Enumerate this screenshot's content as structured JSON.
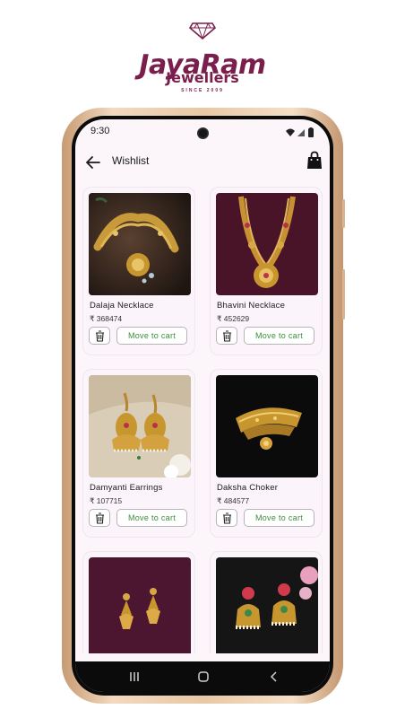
{
  "brand": {
    "name": "JayaRam",
    "subtitle": "Jewellers",
    "since": "SINCE 2009",
    "logo_icon": "diamond-logo-icon",
    "color": "#7a1f4c"
  },
  "status_bar": {
    "time": "9:30",
    "icons": [
      "wifi-icon",
      "signal-icon",
      "battery-icon"
    ]
  },
  "app_bar": {
    "back_icon": "arrow-left-icon",
    "title": "Wishlist",
    "bag_icon": "shopping-bag-icon"
  },
  "wishlist": {
    "currency": "₹",
    "delete_icon": "trash-icon",
    "move_to_cart_label": "Move to cart",
    "accent_color": "#3a8f3a",
    "items": [
      {
        "name": "Dalaja Necklace",
        "price": "₹ 368474",
        "image": "gold-necklace-on-dark-stand"
      },
      {
        "name": "Bhavini Necklace",
        "price": "₹ 452629",
        "image": "long-gold-necklace-on-maroon"
      },
      {
        "name": "Damyanti Earrings",
        "price": "₹ 107715",
        "image": "jhumka-earrings-on-cream"
      },
      {
        "name": "Daksha Choker",
        "price": "₹ 484577",
        "image": "gold-choker-on-black"
      },
      {
        "name": "",
        "price": "",
        "image": "drop-earrings-on-maroon"
      },
      {
        "name": "",
        "price": "",
        "image": "kundan-jhumkas-on-dark"
      }
    ]
  },
  "nav_bar": {
    "items": [
      "recents-icon",
      "home-icon",
      "back-icon"
    ]
  }
}
